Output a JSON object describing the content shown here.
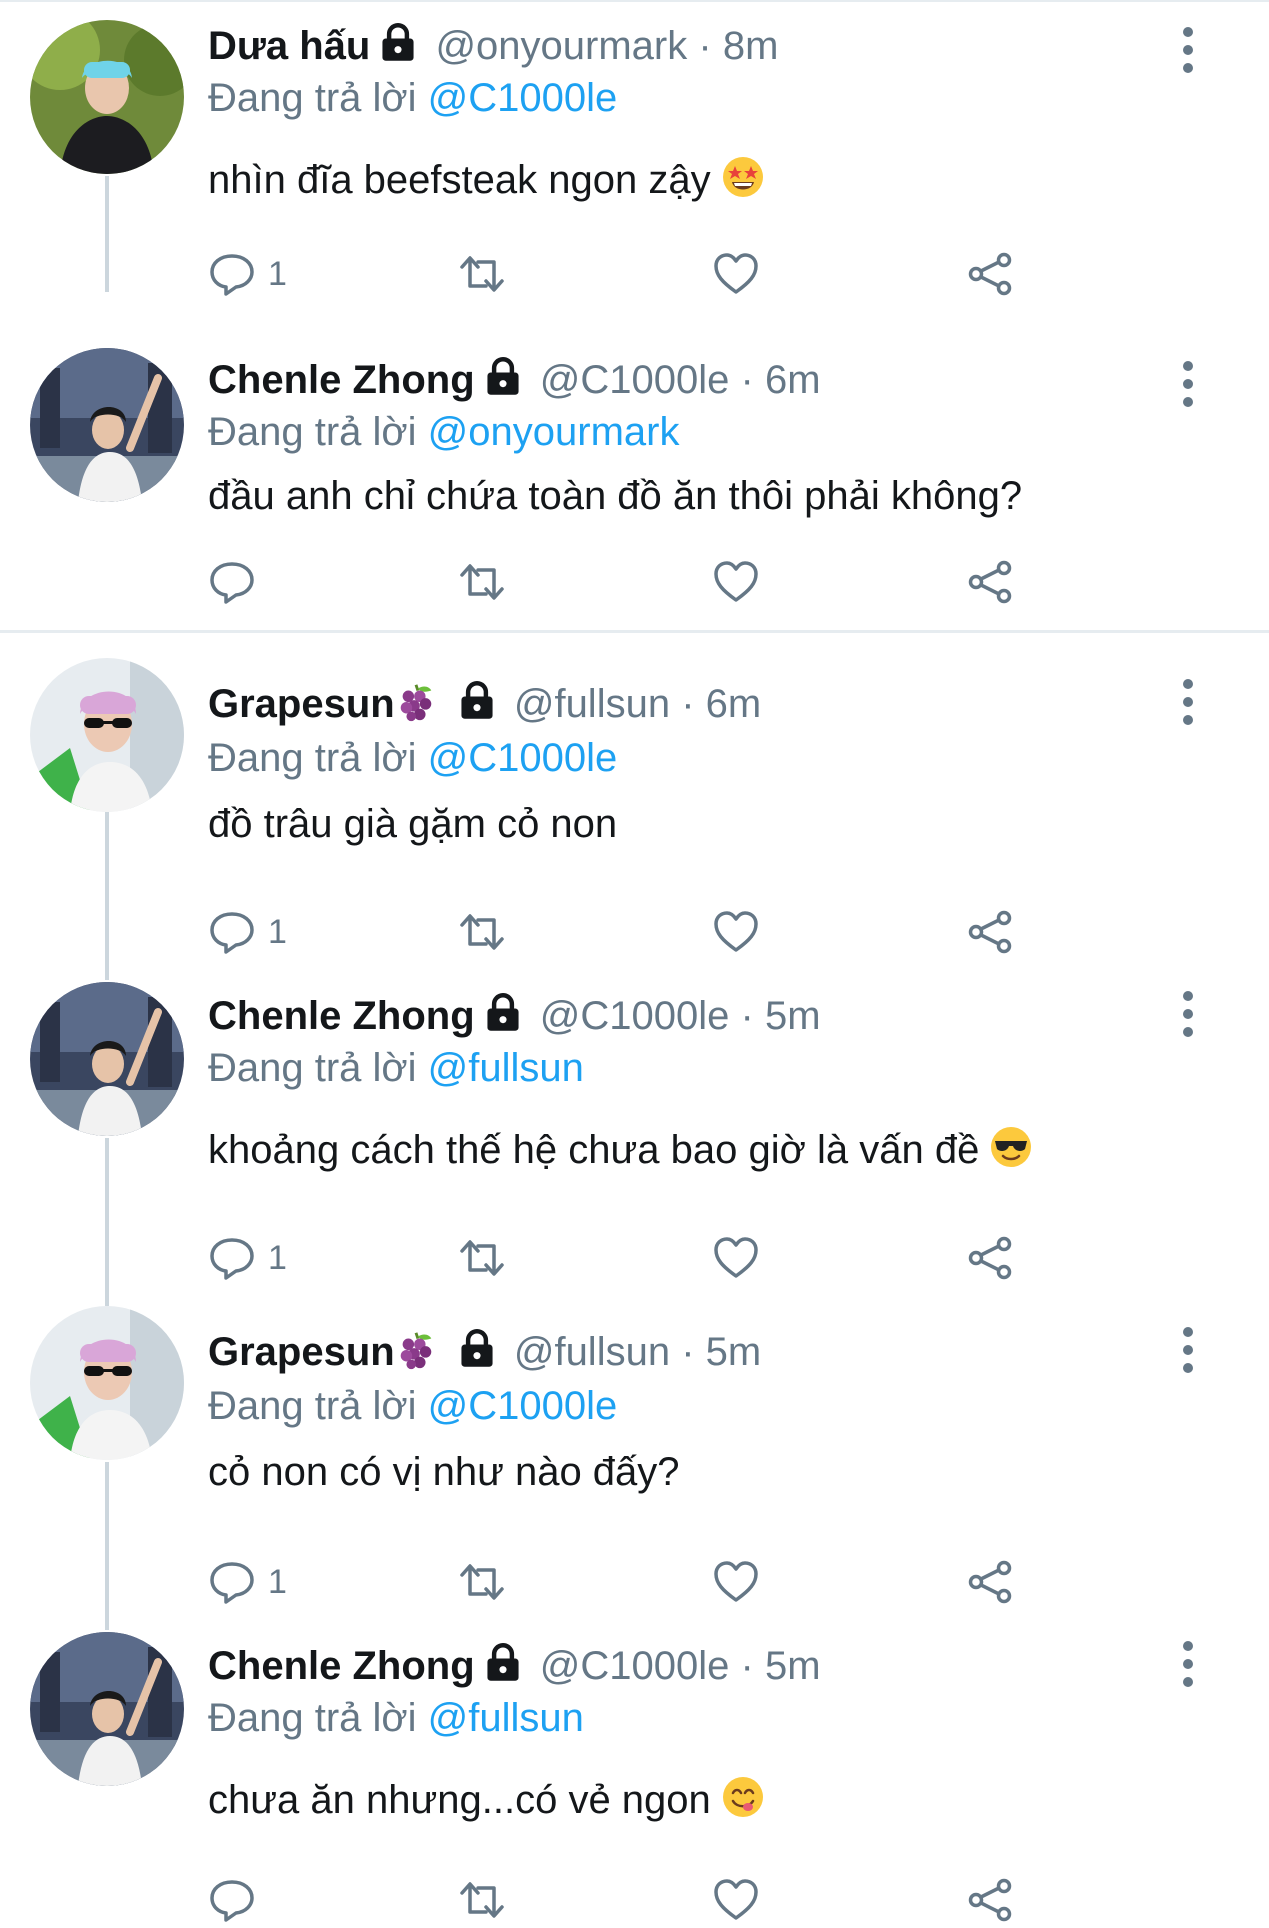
{
  "replying_prefix": "Đang trả lời",
  "separator": "·",
  "colors": {
    "mention": "#1da1f2",
    "muted": "#657786",
    "text": "#14171a",
    "line": "#ccd6dd"
  },
  "tweets": [
    {
      "name": "Dưa hấu",
      "handle": "@onyourmark",
      "time": "8m",
      "replying_to": "@C1000le",
      "text": "nhìn đĩa beefsteak ngon zậy",
      "emoji": "star-struck-emoji",
      "reply_count": "1"
    },
    {
      "name": "Chenle Zhong",
      "handle": "@C1000le",
      "time": "6m",
      "replying_to": "@onyourmark",
      "text": "đầu anh chỉ chứa toàn đồ ăn thôi phải không?",
      "emoji": "",
      "reply_count": ""
    },
    {
      "name": "Grapesun",
      "handle": "@fullsun",
      "time": "6m",
      "replying_to": "@C1000le",
      "text": "đồ trâu già gặm cỏ non",
      "emoji": "",
      "reply_count": "1"
    },
    {
      "name": "Chenle Zhong",
      "handle": "@C1000le",
      "time": "5m",
      "replying_to": "@fullsun",
      "text": "khoảng cách thế hệ chưa bao giờ là vấn đề",
      "emoji": "sunglasses-emoji",
      "reply_count": "1"
    },
    {
      "name": "Grapesun",
      "handle": "@fullsun",
      "time": "5m",
      "replying_to": "@C1000le",
      "text": "cỏ non có vị như nào đấy?",
      "emoji": "",
      "reply_count": "1"
    },
    {
      "name": "Chenle Zhong",
      "handle": "@C1000le",
      "time": "5m",
      "replying_to": "@fullsun",
      "text": "chưa ăn nhưng...có vẻ ngon",
      "emoji": "yum-emoji",
      "reply_count": ""
    }
  ]
}
